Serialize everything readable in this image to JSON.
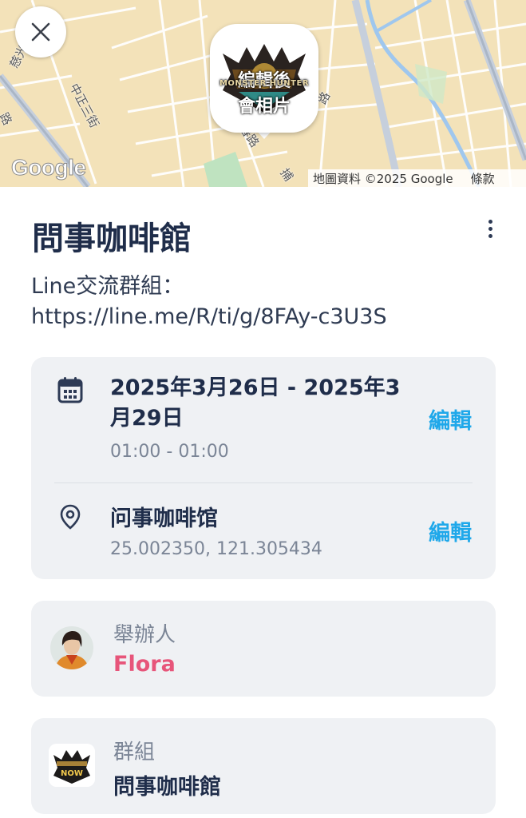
{
  "map": {
    "street_labels": [
      "慈光",
      "中正三街",
      "路",
      "長春路",
      "捕",
      "路"
    ],
    "google_mark": "Google",
    "attribution": "地圖資料 ©2025 Google",
    "terms": "條款",
    "pin": {
      "brand_text": "MONSTER HUNTER",
      "line1": "編輯後",
      "line2": "會相片"
    }
  },
  "event": {
    "title": "問事咖啡館",
    "description": "Line交流群組：\nhttps://line.me/R/ti/g/8FAy-c3U3S",
    "date_range": "2025年3月26日 - 2025年3月29日",
    "time_range": "01:00 - 01:00",
    "edit_date_label": "編輯",
    "location_name": "问事咖啡馆",
    "location_coords": "25.002350, 121.305434",
    "edit_location_label": "編輯"
  },
  "host": {
    "label": "舉辦人",
    "name": "Flora"
  },
  "group": {
    "label": "群組",
    "name": "問事咖啡館",
    "logo_text": "NOW"
  },
  "icons": {
    "close": "close-icon",
    "more": "more-vertical-icon",
    "calendar": "calendar-icon",
    "location": "location-pin-icon"
  },
  "colors": {
    "title": "#1f2d4a",
    "edit_link": "#1fa8ea",
    "host_name": "#e7557a",
    "card_bg": "#eff1f4",
    "secondary_text": "#7b8596"
  }
}
